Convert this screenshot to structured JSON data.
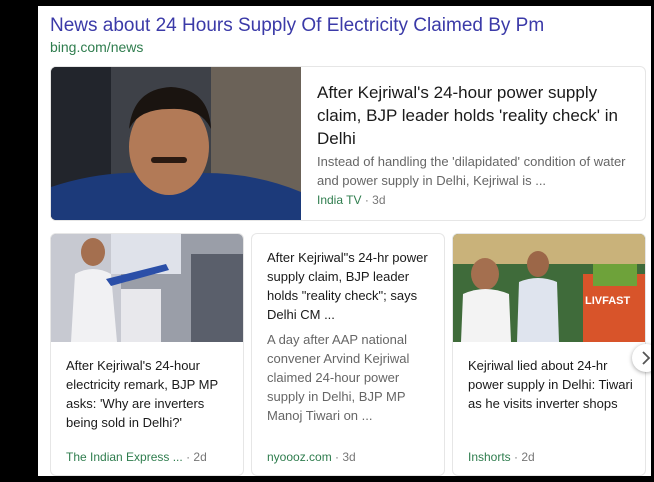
{
  "header": {
    "title": "News about 24 Hours Supply Of Electricity Claimed By Pm",
    "source": "bing.com/news"
  },
  "top_story": {
    "title": "After Kejriwal's 24-hour power supply claim, BJP leader holds 'reality check' in Delhi",
    "snippet": "Instead of handling the 'dilapidated' condition of water and power supply in Delhi, Kejriwal is ...",
    "source": "India TV",
    "age": "· 3d"
  },
  "cards": [
    {
      "title": "After Kejriwal's 24-hour electricity remark, BJP MP asks: 'Why are inverters being sold in Delhi?'",
      "source": "The Indian Express ...",
      "age": "· 2d"
    },
    {
      "title": "After Kejriwal\"s 24-hr power supply claim, BJP leader holds \"reality check\"; says Delhi CM ...",
      "snippet": "A day after AAP national convener Arvind Kejriwal claimed 24-hour power supply in Delhi, BJP MP Manoj Tiwari on ...",
      "source": "nyoooz.com",
      "age": "· 3d"
    },
    {
      "title": "Kejriwal lied about 24-hr power supply in Delhi: Tiwari as he visits inverter shops",
      "source": "Inshorts",
      "age": "· 2d"
    }
  ],
  "shop_sign": "LIVFAST",
  "colors": {
    "title_link": "#3b3aa8",
    "source_green": "#2f7d4e",
    "snippet_gray": "#666666"
  },
  "icons": {
    "next": "chevron-right-icon"
  }
}
